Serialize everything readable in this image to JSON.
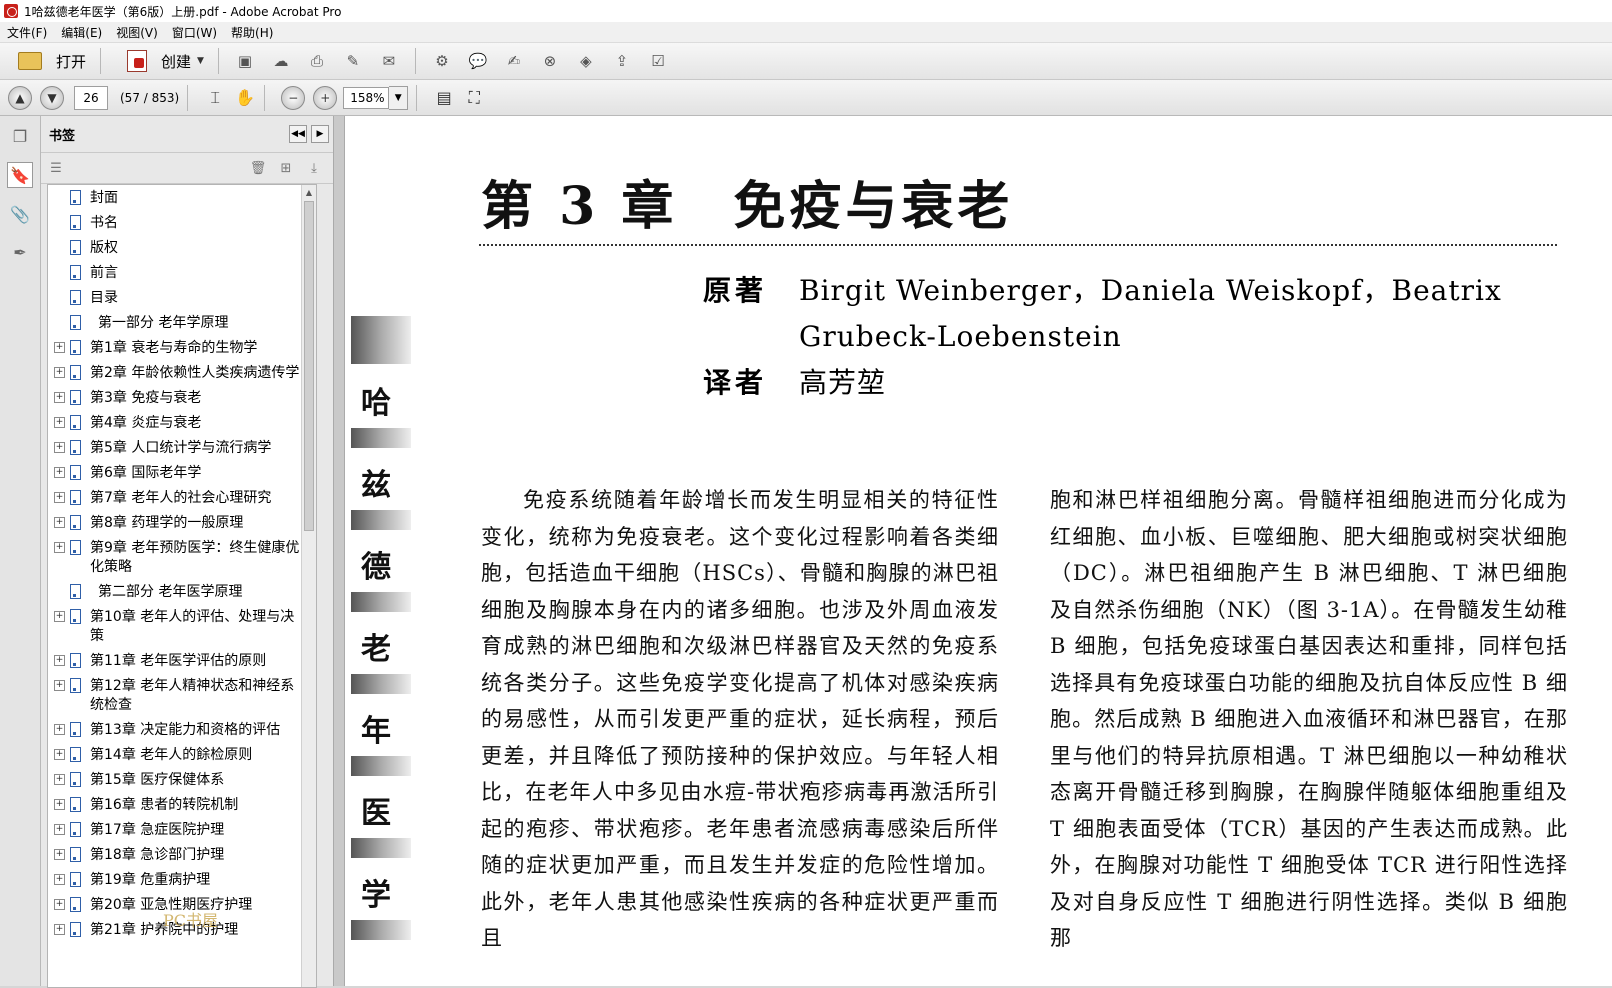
{
  "window": {
    "title": "1哈兹德老年医学（第6版）上册.pdf - Adobe Acrobat Pro"
  },
  "menu": [
    "文件(F)",
    "编辑(E)",
    "视图(V)",
    "窗口(W)",
    "帮助(H)"
  ],
  "toolbar": {
    "open_label": "打开",
    "create_label": "创建"
  },
  "nav": {
    "page_value": "26",
    "page_count": "(57 / 853)",
    "zoom": "158%"
  },
  "bookmarks": {
    "title": "书签",
    "items": [
      {
        "label": "封面",
        "expandable": false,
        "part": false
      },
      {
        "label": "书名",
        "expandable": false,
        "part": false
      },
      {
        "label": "版权",
        "expandable": false,
        "part": false
      },
      {
        "label": "前言",
        "expandable": false,
        "part": false
      },
      {
        "label": "目录",
        "expandable": false,
        "part": false
      },
      {
        "label": "第一部分 老年学原理",
        "expandable": false,
        "part": true
      },
      {
        "label": "第1章 衰老与寿命的生物学",
        "expandable": true,
        "part": false
      },
      {
        "label": "第2章 年龄依赖性人类疾病遗传学",
        "expandable": true,
        "part": false
      },
      {
        "label": "第3章 免疫与衰老",
        "expandable": true,
        "part": false
      },
      {
        "label": "第4章 炎症与衰老",
        "expandable": true,
        "part": false
      },
      {
        "label": "第5章 人口统计学与流行病学",
        "expandable": true,
        "part": false
      },
      {
        "label": "第6章 国际老年学",
        "expandable": true,
        "part": false
      },
      {
        "label": "第7章 老年人的社会心理研究",
        "expandable": true,
        "part": false
      },
      {
        "label": "第8章 药理学的一般原理",
        "expandable": true,
        "part": false
      },
      {
        "label": "第9章 老年预防医学：终生健康优化策略",
        "expandable": true,
        "part": false
      },
      {
        "label": "第二部分 老年医学原理",
        "expandable": false,
        "part": true
      },
      {
        "label": "第10章 老年人的评估、处理与决策",
        "expandable": true,
        "part": false
      },
      {
        "label": "第11章 老年医学评估的原则",
        "expandable": true,
        "part": false
      },
      {
        "label": "第12章 老年人精神状态和神经系统检查",
        "expandable": true,
        "part": false
      },
      {
        "label": "第13章 决定能力和资格的评估",
        "expandable": true,
        "part": false
      },
      {
        "label": "第14章 老年人的餘检原则",
        "expandable": true,
        "part": false
      },
      {
        "label": "第15章 医疗保健体系",
        "expandable": true,
        "part": false
      },
      {
        "label": "第16章 患者的转院机制",
        "expandable": true,
        "part": false
      },
      {
        "label": "第17章 急症医院护理",
        "expandable": true,
        "part": false
      },
      {
        "label": "第18章 急诊部门护理",
        "expandable": true,
        "part": false
      },
      {
        "label": "第19章 危重病护理",
        "expandable": true,
        "part": false
      },
      {
        "label": "第20章 亚急性期医疗护理",
        "expandable": true,
        "part": false
      },
      {
        "label": "第21章 护养院中的护理",
        "expandable": true,
        "part": false
      }
    ]
  },
  "document": {
    "spine_chars": [
      "哈",
      "兹",
      "德",
      "老",
      "年",
      "医",
      "学"
    ],
    "chapter_title": "第 3 章　免疫与衰老",
    "author_role": "原著",
    "authors": "Birgit Weinberger，Daniela Weiskopf，Beatrix Grubeck-Loebenstein",
    "translator_role": "译者",
    "translator": "高芳堃",
    "left_column": "免疫系统随着年龄增长而发生明显相关的特征性变化，统称为免疫衰老。这个变化过程影响着各类细胞，包括造血干细胞（HSCs）、骨髓和胸腺的淋巴祖细胞及胸腺本身在内的诸多细胞。也涉及外周血液发育成熟的淋巴细胞和次级淋巴样器官及天然的免疫系统各类分子。这些免疫学变化提高了机体对感染疾病的易感性，从而引发更严重的症状，延长病程，预后更差，并且降低了预防接种的保护效应。与年轻人相比，在老年人中多见由水痘-带状疱疹病毒再激活所引起的疱疹、带状疱疹。老年患者流感病毒感染后所伴随的症状更加严重，而且发生并发症的危险性增加。此外，老年人患其他感染性疾病的各种症状更严重而且",
    "right_column": "胞和淋巴样祖细胞分离。骨髓样祖细胞进而分化成为红细胞、血小板、巨噬细胞、肥大细胞或树突状细胞（DC）。淋巴祖细胞产生 B 淋巴细胞、T 淋巴细胞及自然杀伤细胞（NK）（图 3-1A）。在骨髓发生幼稚 B 细胞，包括免疫球蛋白基因表达和重排，同样包括选择具有免疫球蛋白功能的细胞及抗自体反应性 B 细胞。然后成熟 B 细胞进入血液循环和淋巴器官，在那里与他们的特异抗原相遇。T 淋巴细胞以一种幼稚状态离开骨髓迁移到胸腺，在胸腺伴随躯体细胞重组及 T 细胞表面受体（TCR）基因的产生表达而成熟。此外，在胸腺对功能性 T 细胞受体 TCR 进行阳性选择及对自身反应性 T 细胞进行阴性选择。类似 B 细胞那",
    "watermark": "PC书屋"
  }
}
